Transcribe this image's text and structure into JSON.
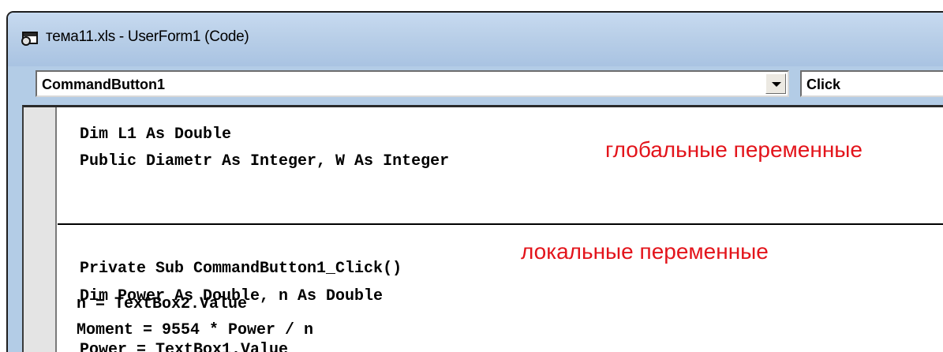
{
  "window": {
    "title": "тема11.xls - UserForm1 (Code)",
    "title_icon": "vba-code-window-icon"
  },
  "object_selector": {
    "value": "CommandButton1"
  },
  "procedure_selector": {
    "value": "Click"
  },
  "code": {
    "declarations": [
      "Dim L1 As Double",
      "Public Diametr As Integer, W As Integer"
    ],
    "procedure": [
      "Private Sub CommandButton1_Click()",
      "Dim Power As Double, n As Double",
      "",
      "Power = TextBox1.Value",
      "n = TextBox2.Value",
      "Moment = 9554 * Power / n"
    ]
  },
  "annotations": {
    "global": "глобальные переменные",
    "local": "локальные переменные"
  },
  "colors": {
    "annotation": "#e3141b",
    "titlebar": "#b9cfe8"
  }
}
